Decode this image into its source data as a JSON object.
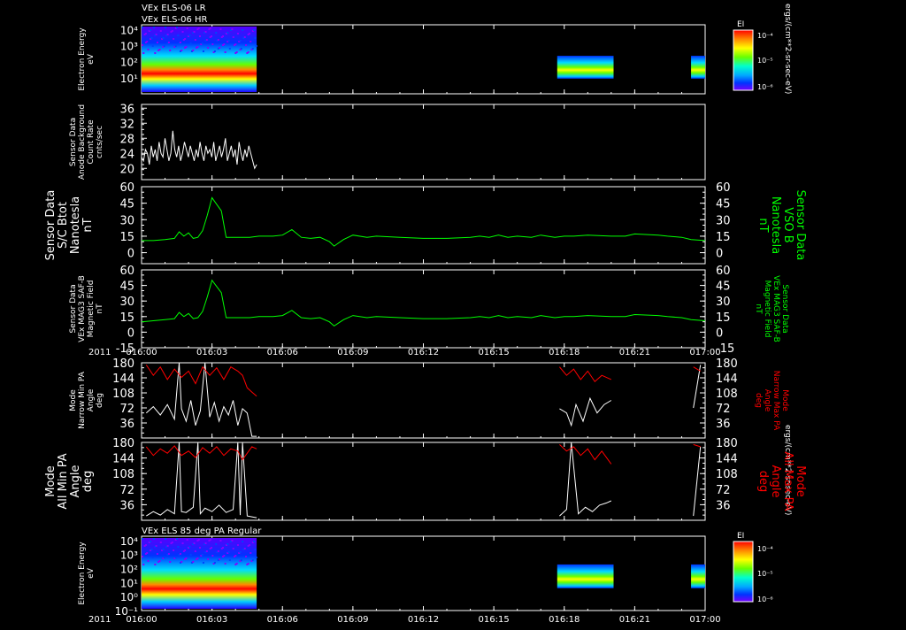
{
  "header": {
    "line1": "VEx ELS-06 LR",
    "line2": "VEx ELS-06 HR",
    "panel7_title": "VEx ELS 85 deg PA Regular"
  },
  "time_axis": {
    "year": "2011",
    "ticks": [
      "016:00",
      "016:03",
      "016:06",
      "016:09",
      "016:12",
      "016:15",
      "016:18",
      "016:21",
      "017:00"
    ],
    "range_minutes": [
      0,
      24
    ]
  },
  "colorbar": {
    "title": "EI",
    "units": "ergs/(cm**2-sr-sec-eV)",
    "ticks_top": [
      "10⁻⁴",
      "10⁻⁵",
      "10⁻⁶"
    ],
    "ticks_bottom": [
      "10⁻⁴",
      "10⁻⁵",
      "10⁻⁶"
    ],
    "colors": [
      "#ff0000",
      "#ff8800",
      "#ffff00",
      "#66ff00",
      "#00ffcc",
      "#00aaff",
      "#0033ff",
      "#7700ff"
    ]
  },
  "colors": {
    "white": "#ffffff",
    "green": "#00ff00",
    "red": "#ff0000"
  },
  "chart_data": [
    {
      "type": "heatmap",
      "id": "p1",
      "ylabel": [
        "Electron Energy",
        "eV"
      ],
      "ylog": true,
      "ylim": [
        1,
        20000
      ],
      "yticks": [
        "10⁴",
        "10³",
        "10²",
        "10¹"
      ],
      "data_intervals_min": [
        [
          0,
          4.9
        ],
        [
          17.7,
          20.1
        ],
        [
          23.4,
          24
        ]
      ]
    },
    {
      "type": "line",
      "id": "p2",
      "ylabel": [
        "Sensor Data",
        "Anode Background",
        "Count Rate",
        "cnts/sec"
      ],
      "ylim": [
        17,
        37
      ],
      "yticks": [
        36,
        32,
        28,
        24,
        20
      ],
      "series": [
        {
          "color": "white",
          "x_range_min": [
            0,
            4.9
          ],
          "values": [
            23,
            22,
            25,
            24,
            21,
            26,
            23,
            25,
            22,
            27,
            24,
            23,
            28,
            25,
            22,
            24,
            30,
            25,
            23,
            26,
            22,
            24,
            27,
            25,
            23,
            26,
            24,
            22,
            25,
            23,
            27,
            24,
            22,
            26,
            24,
            25,
            23,
            27,
            22,
            24,
            26,
            23,
            25,
            28,
            22,
            24,
            26,
            23,
            25,
            21,
            27,
            24,
            22,
            25,
            23,
            26,
            24,
            22,
            20,
            21
          ]
        }
      ]
    },
    {
      "type": "line",
      "id": "p3",
      "ylabel": [
        "Sensor Data",
        "S/C Btot",
        "Nanotesla",
        "nT"
      ],
      "ylabel_right": [
        "Sensor Data",
        "VSO B",
        "Nanotesla",
        "nT"
      ],
      "ylim": [
        -10,
        60
      ],
      "yticks": [
        60,
        45,
        30,
        15,
        0
      ],
      "series": [
        {
          "color": "green",
          "x": [
            0,
            0.5,
            1,
            1.4,
            1.6,
            1.8,
            2,
            2.2,
            2.4,
            2.6,
            2.8,
            3,
            3.2,
            3.4,
            3.6,
            4,
            4.6,
            5,
            5.6,
            6,
            6.4,
            6.8,
            7.2,
            7.6,
            8,
            8.2,
            8.6,
            9,
            9.6,
            10,
            11,
            12,
            13,
            14,
            14.4,
            14.8,
            15.2,
            15.6,
            16,
            16.6,
            17,
            17.6,
            18,
            18.4,
            19,
            20,
            20.6,
            21,
            22,
            22.4,
            23,
            23.4,
            24
          ],
          "values": [
            11,
            11,
            12,
            13,
            19,
            15,
            18,
            13,
            14,
            20,
            34,
            50,
            44,
            38,
            14,
            14,
            14,
            15,
            15,
            16,
            21,
            14,
            13,
            14,
            10,
            6,
            12,
            16,
            14,
            15,
            14,
            13,
            13,
            14,
            15,
            14,
            16,
            14,
            15,
            14,
            16,
            14,
            15,
            15,
            16,
            15,
            15,
            17,
            16,
            15,
            14,
            12,
            11
          ]
        }
      ]
    },
    {
      "type": "line",
      "id": "p4",
      "ylabel": [
        "Sensor Data",
        "VEx MAG3 SAF-B",
        "Magnetic Field",
        "nT"
      ],
      "ylabel_right": [
        "Sensor Data",
        "VEx MAG3 SAF-B",
        "Magnetic Field",
        "nT"
      ],
      "ylim": [
        -15,
        60
      ],
      "yticks": [
        60,
        45,
        30,
        15,
        0,
        -15
      ],
      "series": [
        {
          "color": "green",
          "x": [
            0,
            0.5,
            1,
            1.4,
            1.6,
            1.8,
            2,
            2.2,
            2.4,
            2.6,
            2.8,
            3,
            3.2,
            3.4,
            3.6,
            4,
            4.6,
            5,
            5.6,
            6,
            6.4,
            6.8,
            7.2,
            7.6,
            8,
            8.2,
            8.6,
            9,
            9.6,
            10,
            11,
            12,
            13,
            14,
            14.4,
            14.8,
            15.2,
            15.6,
            16,
            16.6,
            17,
            17.6,
            18,
            18.4,
            19,
            20,
            20.6,
            21,
            22,
            22.4,
            23,
            23.4,
            24
          ],
          "values": [
            10,
            11,
            12,
            13,
            19,
            15,
            18,
            13,
            14,
            20,
            34,
            50,
            44,
            38,
            14,
            14,
            14,
            15,
            15,
            16,
            21,
            14,
            13,
            14,
            10,
            6,
            12,
            16,
            14,
            15,
            14,
            13,
            13,
            14,
            15,
            14,
            16,
            14,
            15,
            14,
            16,
            14,
            15,
            15,
            16,
            15,
            15,
            17,
            16,
            15,
            14,
            12,
            11
          ]
        }
      ]
    },
    {
      "type": "line",
      "id": "p5",
      "ylabel": [
        "Mode",
        "Narrow Min PA",
        "Angle",
        "deg"
      ],
      "ylabel_right": [
        "Mode",
        "Narrow Max PA",
        "Angle",
        "deg"
      ],
      "ylim": [
        0,
        180
      ],
      "yticks": [
        180,
        144,
        108,
        72,
        36
      ],
      "series": [
        {
          "name": "Narrow Min PA",
          "color": "white",
          "x": [
            0.2,
            0.5,
            0.8,
            1.1,
            1.4,
            1.6,
            1.7,
            1.9,
            2.1,
            2.3,
            2.5,
            2.7,
            2.9,
            3.1,
            3.3,
            3.5,
            3.7,
            3.9,
            4.1,
            4.3,
            4.5,
            4.7,
            4.9,
            17.8,
            18.1,
            18.3,
            18.5,
            18.8,
            19.1,
            19.4,
            19.7,
            20,
            23.5,
            23.8
          ],
          "values": [
            60,
            75,
            55,
            80,
            45,
            180,
            70,
            40,
            90,
            30,
            65,
            180,
            50,
            85,
            40,
            75,
            55,
            90,
            30,
            70,
            60,
            4,
            4,
            70,
            60,
            30,
            80,
            40,
            95,
            60,
            80,
            90,
            72,
            175
          ]
        },
        {
          "name": "Narrow Max PA",
          "color": "red",
          "x": [
            0.2,
            0.5,
            0.8,
            1.1,
            1.4,
            1.7,
            2,
            2.3,
            2.6,
            2.9,
            3.2,
            3.5,
            3.8,
            4.1,
            4.3,
            4.5,
            4.7,
            4.9,
            17.8,
            18.1,
            18.4,
            18.7,
            19,
            19.3,
            19.6,
            20,
            23.5,
            23.8
          ],
          "values": [
            175,
            150,
            170,
            140,
            165,
            145,
            160,
            130,
            170,
            150,
            168,
            140,
            170,
            160,
            150,
            120,
            110,
            100,
            170,
            150,
            165,
            140,
            160,
            135,
            150,
            140,
            170,
            160
          ]
        }
      ]
    },
    {
      "type": "line",
      "id": "p6",
      "ylabel": [
        "Mode",
        "All Min PA",
        "Angle",
        "deg"
      ],
      "ylabel_right": [
        "Mode",
        "All Max PA",
        "Angle",
        "deg"
      ],
      "ylim": [
        0,
        180
      ],
      "yticks": [
        180,
        144,
        108,
        72,
        36
      ],
      "series": [
        {
          "name": "All Min PA",
          "color": "white",
          "x": [
            0.2,
            0.5,
            0.8,
            1.1,
            1.4,
            1.6,
            1.7,
            1.9,
            2.2,
            2.4,
            2.5,
            2.7,
            3,
            3.3,
            3.6,
            3.9,
            4.1,
            4.2,
            4.3,
            4.5,
            4.7,
            4.9,
            17.8,
            18.1,
            18.3,
            18.6,
            18.9,
            19.2,
            19.5,
            19.8,
            20,
            23.5,
            23.8
          ],
          "values": [
            10,
            20,
            12,
            25,
            15,
            180,
            20,
            18,
            30,
            180,
            15,
            28,
            20,
            35,
            18,
            25,
            180,
            12,
            180,
            10,
            8,
            6,
            10,
            25,
            180,
            15,
            30,
            20,
            35,
            40,
            45,
            10,
            170
          ]
        },
        {
          "name": "All Max PA",
          "color": "red",
          "x": [
            0.2,
            0.5,
            0.8,
            1.1,
            1.4,
            1.7,
            2,
            2.3,
            2.6,
            2.9,
            3.2,
            3.5,
            3.8,
            4.1,
            4.3,
            4.5,
            4.7,
            4.9,
            17.8,
            18.1,
            18.4,
            18.7,
            19,
            19.3,
            19.6,
            20,
            23.5,
            23.8
          ],
          "values": [
            170,
            150,
            165,
            155,
            172,
            150,
            160,
            145,
            168,
            155,
            170,
            150,
            165,
            160,
            140,
            155,
            170,
            165,
            175,
            160,
            170,
            150,
            165,
            140,
            160,
            130,
            175,
            170
          ]
        }
      ]
    },
    {
      "type": "heatmap",
      "id": "p7",
      "ylabel": [
        "Electron Energy",
        "eV"
      ],
      "ylog": true,
      "ylim": [
        0.1,
        20000
      ],
      "yticks": [
        "10⁴",
        "10³",
        "10²",
        "10¹",
        "10⁰",
        "10⁻¹"
      ],
      "data_intervals_min": [
        [
          0,
          4.9
        ],
        [
          17.7,
          20.1
        ],
        [
          23.4,
          24
        ]
      ]
    }
  ]
}
